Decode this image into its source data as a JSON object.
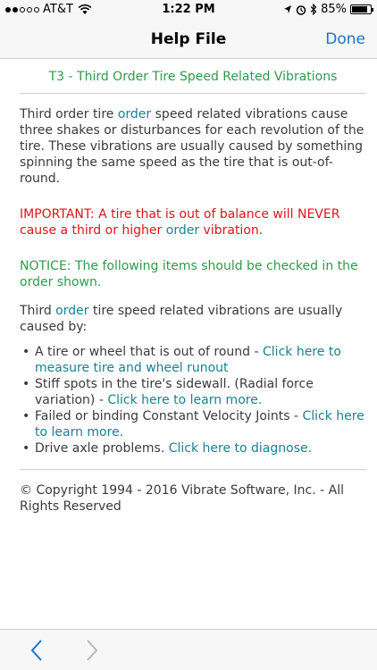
{
  "status_bar": {
    "carrier": "AT&T",
    "time": "1:22 PM",
    "battery": "85%",
    "battery_level": 0.85,
    "icons": [
      "wifi-icon",
      "location-icon",
      "alarm-icon",
      "bluetooth-icon"
    ]
  },
  "nav": {
    "title": "Help File",
    "done_label": "Done"
  },
  "doc": {
    "title": "T3 - Third Order Tire Speed Related Vibrations",
    "intro_a": "Third order tire ",
    "intro_link": "order",
    "intro_b": " speed related vibrations cause three shakes or disturbances for each revolution of the tire. These vibrations are usually caused by something spinning the same speed as the tire that is out-of-round.",
    "important_a": "IMPORTANT: A tire that is out of balance will NEVER cause a third or higher ",
    "important_link": "order",
    "important_b": " vibration.",
    "notice": "NOTICE: The following items should be checked in the order shown.",
    "caused_a": "Third ",
    "caused_link": "order",
    "caused_b": " tire speed related vibrations are usually caused by:",
    "items": [
      {
        "text": "A tire or wheel that is out of round - ",
        "link": "Click here to measure tire and wheel runout"
      },
      {
        "text": "Stiff spots in the tire's sidewall. (Radial force variation) - ",
        "link": "Click here to learn more."
      },
      {
        "text": "Failed or binding Constant Velocity Joints - ",
        "link": "Click here to learn more."
      },
      {
        "text": "Drive axle problems. ",
        "link": "Click here to diagnose."
      }
    ],
    "copyright": "© Copyright 1994 - 2016 Vibrate Software, Inc. - All Rights Reserved"
  },
  "colors": {
    "link": "#1a8090",
    "done": "#1a73c8",
    "important": "#e0121b",
    "notice": "#2f9a4a"
  },
  "toolbar": {
    "icons": [
      "back-chevron-icon",
      "forward-chevron-icon"
    ]
  }
}
